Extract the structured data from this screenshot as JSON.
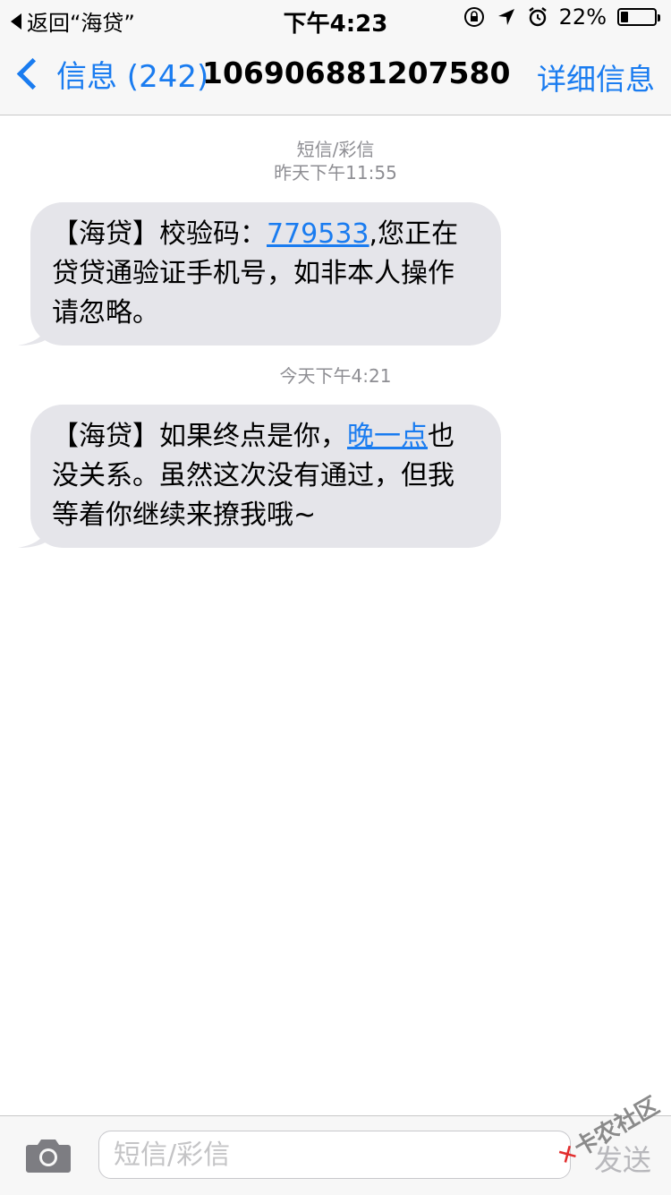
{
  "status_bar": {
    "back_app": "返回“海贷”",
    "time": "下午4:23",
    "battery_percent": "22%",
    "battery_level": 0.22,
    "icons": [
      "orientation-lock-icon",
      "location-arrow-icon",
      "alarm-icon",
      "battery-icon"
    ]
  },
  "nav": {
    "back_label": "信息 (242)",
    "title": "106906881207580",
    "details_label": "详细信息"
  },
  "messages": [
    {
      "type_label": "短信/彩信",
      "timestamp": "昨天下午11:55",
      "text_before": "【海贷】校验码：",
      "link_text": "779533",
      "text_after": ",您正在贷贷通验证手机号，如非本人操作请忽略。"
    },
    {
      "timestamp": "今天下午4:21",
      "text_before": "【海贷】如果终点是你，",
      "link_text": "晚一点",
      "text_after": "也没关系。虽然这次没有通过，但我等着你继续来撩我哦~"
    }
  ],
  "input_bar": {
    "placeholder": "短信/彩信",
    "send_label": "发送"
  },
  "watermark": {
    "mark": "✕",
    "text": "卡农社区"
  },
  "colors": {
    "accent": "#1a7cf0",
    "bubble": "#e5e5ea",
    "bar_background": "#f7f7f7",
    "muted": "#8e8e93"
  }
}
